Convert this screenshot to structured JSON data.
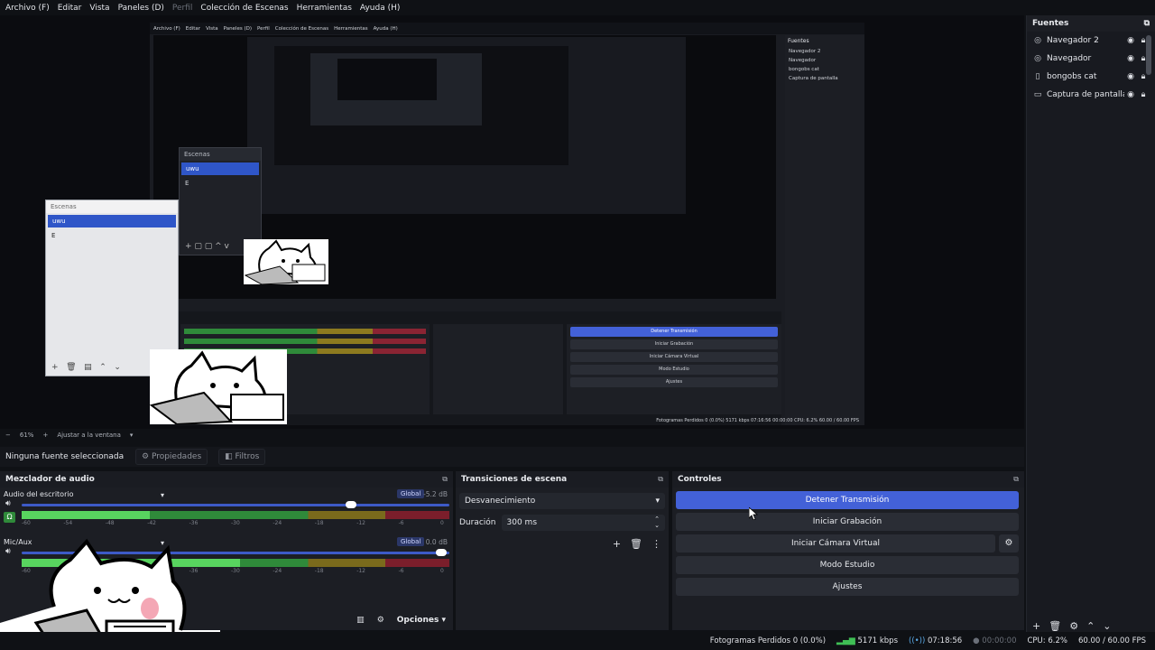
{
  "menu": [
    "Archivo (F)",
    "Editar",
    "Vista",
    "Paneles (D)",
    "Perfil",
    "Colección de Escenas",
    "Herramientas",
    "Ayuda (H)"
  ],
  "preview": {
    "nested_menu": [
      "Archivo (F)",
      "Editar",
      "Vista",
      "Paneles (D)",
      "Perfil",
      "Colección de Escenas",
      "Herramientas",
      "Ayuda (H)"
    ],
    "scenes_panel_title": "Escenas",
    "scenes": [
      "uwu",
      "E"
    ],
    "nested_sources_title": "Fuentes",
    "nested_sources": [
      "Navegador 2",
      "Navegador",
      "bongobs cat",
      "Captura de pantalla"
    ],
    "nested_controls": [
      "Detener Transmisión",
      "Iniciar Grabación",
      "Iniciar Cámara Virtual",
      "Modo Estudio",
      "Ajustes"
    ],
    "nested_status": "Fotogramas Perdidos 0 (0.0%)   5171 kbps   07:16:56   00:00:00   CPU: 6.2%   60.00 / 60.00 FPS"
  },
  "sources": {
    "title": "Fuentes",
    "items": [
      {
        "label": "Navegador 2",
        "icon": "globe-icon"
      },
      {
        "label": "Navegador",
        "icon": "globe-icon"
      },
      {
        "label": "bongobs cat",
        "icon": "file-icon"
      },
      {
        "label": "Captura de pantalla",
        "icon": "monitor-icon"
      }
    ]
  },
  "zoom": {
    "minus": "−",
    "value": "61%",
    "plus": "+",
    "fit": "Ajustar a la ventana"
  },
  "context": {
    "no_source": "Ninguna fuente seleccionada",
    "properties": "Propiedades",
    "filters": "Filtros"
  },
  "mixer": {
    "title": "Mezclador de audio",
    "channels": [
      {
        "name": "Audio del escritorio",
        "global": "Global",
        "db": "-5.2 dB",
        "volume": 0.77,
        "level": 0.3
      },
      {
        "name": "Mic/Aux",
        "global": "Global",
        "db": "0.0 dB",
        "volume": 0.98,
        "level": 0.51
      }
    ],
    "scale": [
      "-60",
      "-54",
      "-48",
      "-42",
      "-36",
      "-30",
      "-24",
      "-18",
      "-12",
      "-6",
      "0"
    ],
    "options": "Opciones"
  },
  "transitions": {
    "title": "Transiciones de escena",
    "selected": "Desvanecimiento",
    "duration_label": "Duración",
    "duration_value": "300 ms"
  },
  "controls": {
    "title": "Controles",
    "stop_stream": "Detener Transmisión",
    "start_recording": "Iniciar Grabación",
    "start_virtual_cam": "Iniciar Cámara Virtual",
    "studio_mode": "Modo Estudio",
    "settings": "Ajustes"
  },
  "status": {
    "dropped_frames": "Fotogramas Perdidos 0 (0.0%)",
    "bitrate": "5171 kbps",
    "stream_time": "07:18:56",
    "rec_time": "00:00:00",
    "cpu": "CPU: 6.2%",
    "fps": "60.00 / 60.00 FPS"
  }
}
